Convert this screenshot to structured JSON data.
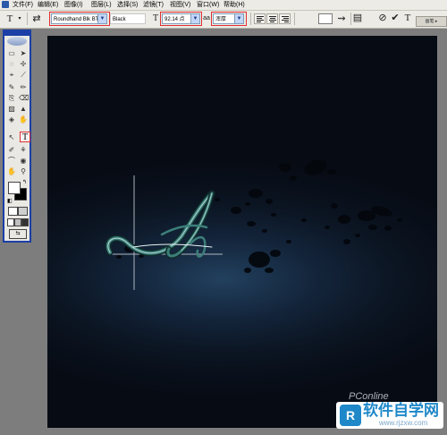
{
  "menu": {
    "items": [
      "文件(F)",
      "编辑(E)",
      "图像(I)",
      "图层(L)",
      "选择(S)",
      "滤镜(T)",
      "视图(V)",
      "窗口(W)",
      "帮助(H)"
    ]
  },
  "options": {
    "tool_glyph": "T",
    "orient_glyph": "⇄",
    "font_family": "Roundhand Blk BT",
    "font_style": "Black",
    "font_size_icon": "T",
    "font_size": "92.14 点",
    "aa_icon": "aa",
    "anti_alias": "浑厚",
    "warp_glyph": "⇝",
    "cancel_glyph": "⊘",
    "commit_glyph": "✔",
    "palette_tab": "画笔 ▸"
  },
  "toolbox": {
    "tools": [
      "▭",
      "➤",
      "◌",
      "✢",
      "⌖",
      "⟋",
      "✎",
      "✏",
      "⎘",
      "⌫",
      "▨",
      "▲",
      "◈",
      "✋",
      "◎",
      "⚲",
      "T",
      "↖",
      "⌒",
      "✐",
      "⚘",
      "◉"
    ],
    "active_tool": "T"
  },
  "canvas": {
    "glyph": "A"
  },
  "watermark": {
    "pconline": "PConline",
    "logo_letter": "R",
    "site_name": "软件自学网",
    "site_url": "www.rjzxw.com"
  },
  "colors": {
    "highlight": "#e03030",
    "toolbox_border": "#1b3fa6",
    "letter_fill": "#3c7f7a"
  }
}
